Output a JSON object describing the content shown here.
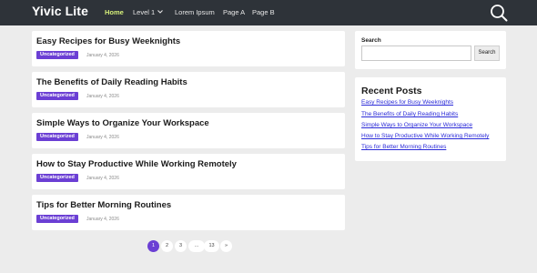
{
  "site": {
    "title": "Yivic Lite"
  },
  "nav": {
    "items": [
      {
        "label": "Home",
        "active": true
      },
      {
        "label": "Level 1",
        "has_dropdown": true
      },
      {
        "label": "Lorem Ipsum"
      },
      {
        "label": "Page A"
      },
      {
        "label": "Page B"
      }
    ],
    "search_icon": "search-icon"
  },
  "posts": [
    {
      "title": "Easy Recipes for Busy Weeknights",
      "category": "Uncategorized",
      "date": "January 4, 2026"
    },
    {
      "title": "The Benefits of Daily Reading Habits",
      "category": "Uncategorized",
      "date": "January 4, 2026"
    },
    {
      "title": "Simple Ways to Organize Your Workspace",
      "category": "Uncategorized",
      "date": "January 4, 2026"
    },
    {
      "title": "How to Stay Productive While Working Remotely",
      "category": "Uncategorized",
      "date": "January 4, 2026"
    },
    {
      "title": "Tips for Better Morning Routines",
      "category": "Uncategorized",
      "date": "January 4, 2026"
    }
  ],
  "pagination": {
    "pages": [
      "1",
      "2",
      "3",
      "…",
      "13",
      "»"
    ],
    "current": "1"
  },
  "sidebar": {
    "search": {
      "title": "Search",
      "button_label": "Search",
      "value": ""
    },
    "recent": {
      "title": "Recent Posts",
      "links": [
        "Easy Recipes for Busy Weeknights",
        "The Benefits of Daily Reading Habits",
        "Simple Ways to Organize Your Workspace",
        "How to Stay Productive While Working Remotely",
        "Tips for Better Morning Routines"
      ]
    }
  },
  "colors": {
    "header_bg": "#2e3339",
    "accent": "#6b3fd4",
    "active_nav": "#d6f07a",
    "link": "#2a2ad8"
  }
}
